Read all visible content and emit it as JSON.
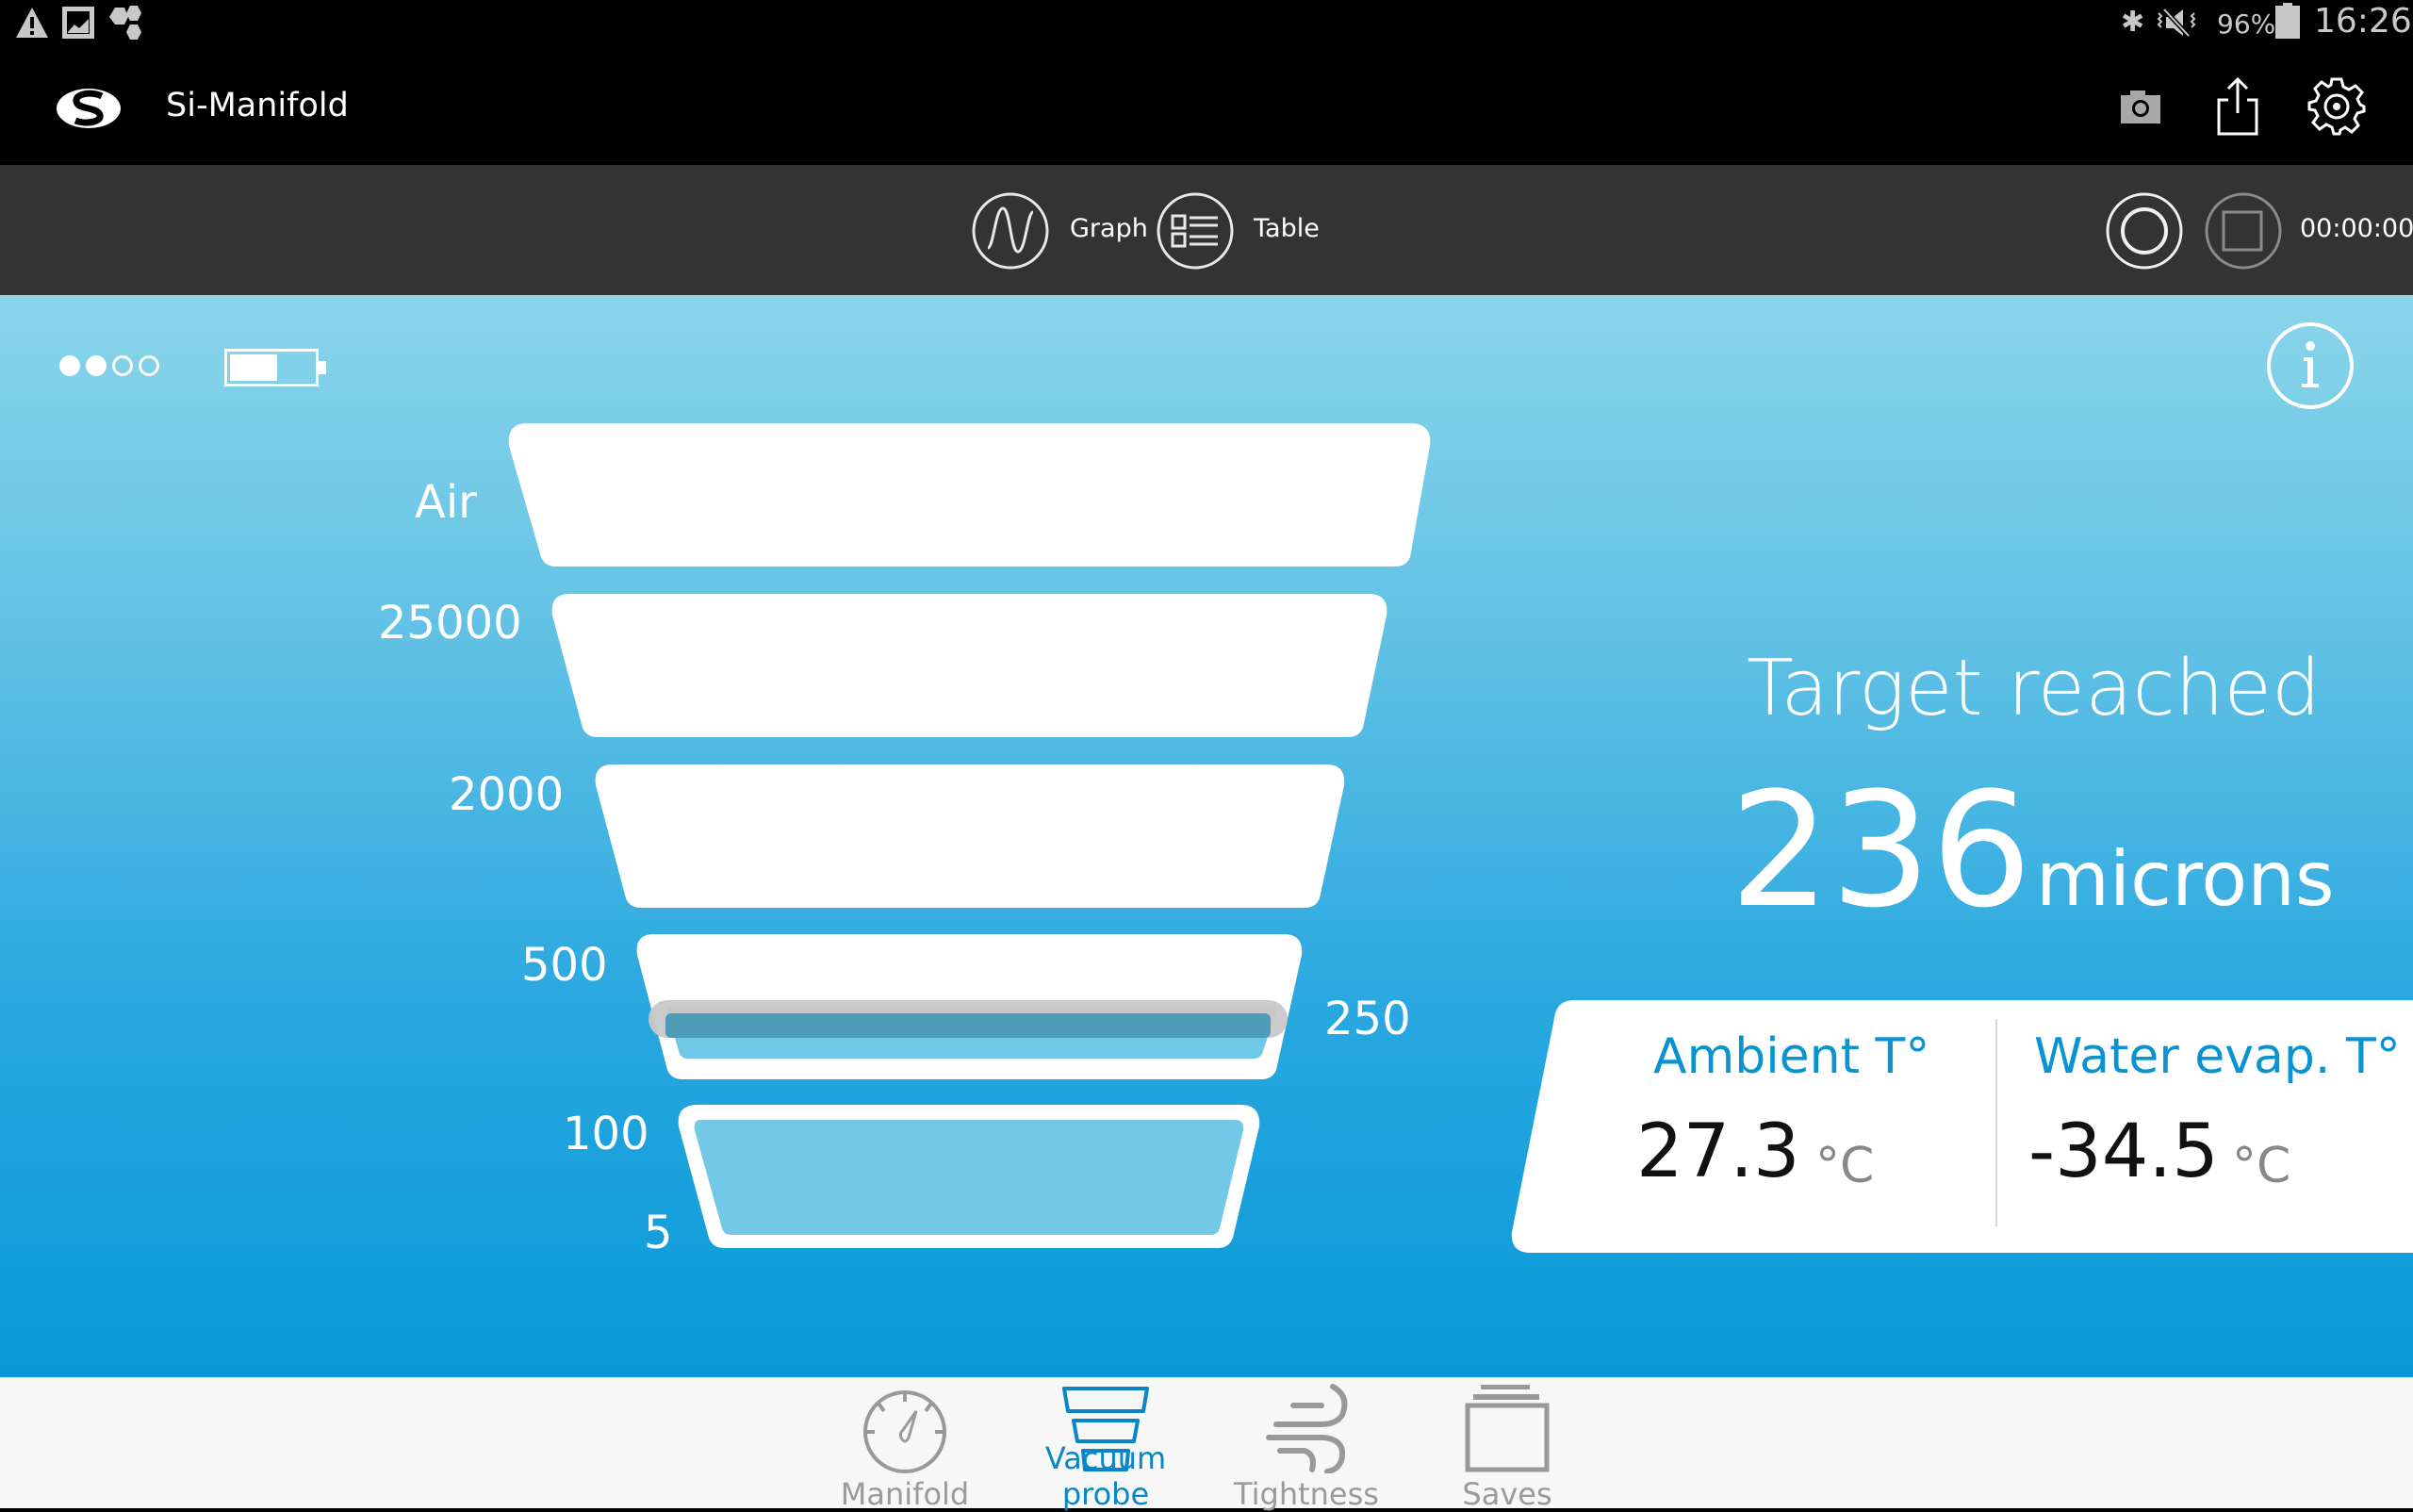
{
  "status_bar": {
    "notification_icons": [
      "warning-icon",
      "image-icon",
      "hexagons-icon"
    ],
    "system_icons": [
      "bluetooth-icon",
      "mute-vibrate-icon"
    ],
    "battery_percent": "96%",
    "time": "16:26"
  },
  "app_bar": {
    "logo": "brand-s-logo",
    "title": "Si-Manifold",
    "actions": [
      "camera-icon",
      "share-icon",
      "settings-icon"
    ]
  },
  "toolbar": {
    "graph_label": "Graph",
    "table_label": "Table",
    "record_icon": "record-icon",
    "stop_icon": "stop-icon",
    "timer": "00:00:00"
  },
  "device": {
    "signal_strength": {
      "filled": 2,
      "total": 4
    },
    "probe_battery_fraction": 0.57
  },
  "funnel": {
    "levels": [
      {
        "label": "Air",
        "state": "empty"
      },
      {
        "label": "25000",
        "state": "empty"
      },
      {
        "label": "2000",
        "state": "empty"
      },
      {
        "label": "500",
        "state": "partial"
      },
      {
        "label": "100",
        "bottom_label": "5",
        "state": "filled"
      }
    ],
    "target_marker_label": "250",
    "colors": {
      "band": "#ffffff",
      "fill": "#6ec8e6",
      "marker": "#c8c8c8",
      "marker_inner": "#4e9cb8"
    }
  },
  "reading": {
    "status": "Target reached",
    "value": "236",
    "unit": "microns"
  },
  "temperatures": {
    "ambient": {
      "title": "Ambient T°",
      "value": "27.3",
      "unit": "°C"
    },
    "water_evap": {
      "title": "Water evap. T°",
      "value": "-34.5",
      "unit": "°C"
    }
  },
  "bottom_nav": {
    "items": [
      {
        "label": "Manifold",
        "icon": "gauge-icon",
        "active": false
      },
      {
        "label": "Vacuum probe",
        "icon": "funnel-icon",
        "active": true
      },
      {
        "label": "Tightness",
        "icon": "wind-icon",
        "active": false
      },
      {
        "label": "Saves",
        "icon": "folder-icon",
        "active": false
      }
    ]
  },
  "colors": {
    "accent": "#0a93d2",
    "toolbar_bg": "#333333",
    "nav_bg": "#f7f7f7",
    "main_gradient_top": "#8ad5ea",
    "main_gradient_bottom": "#0899d8"
  }
}
